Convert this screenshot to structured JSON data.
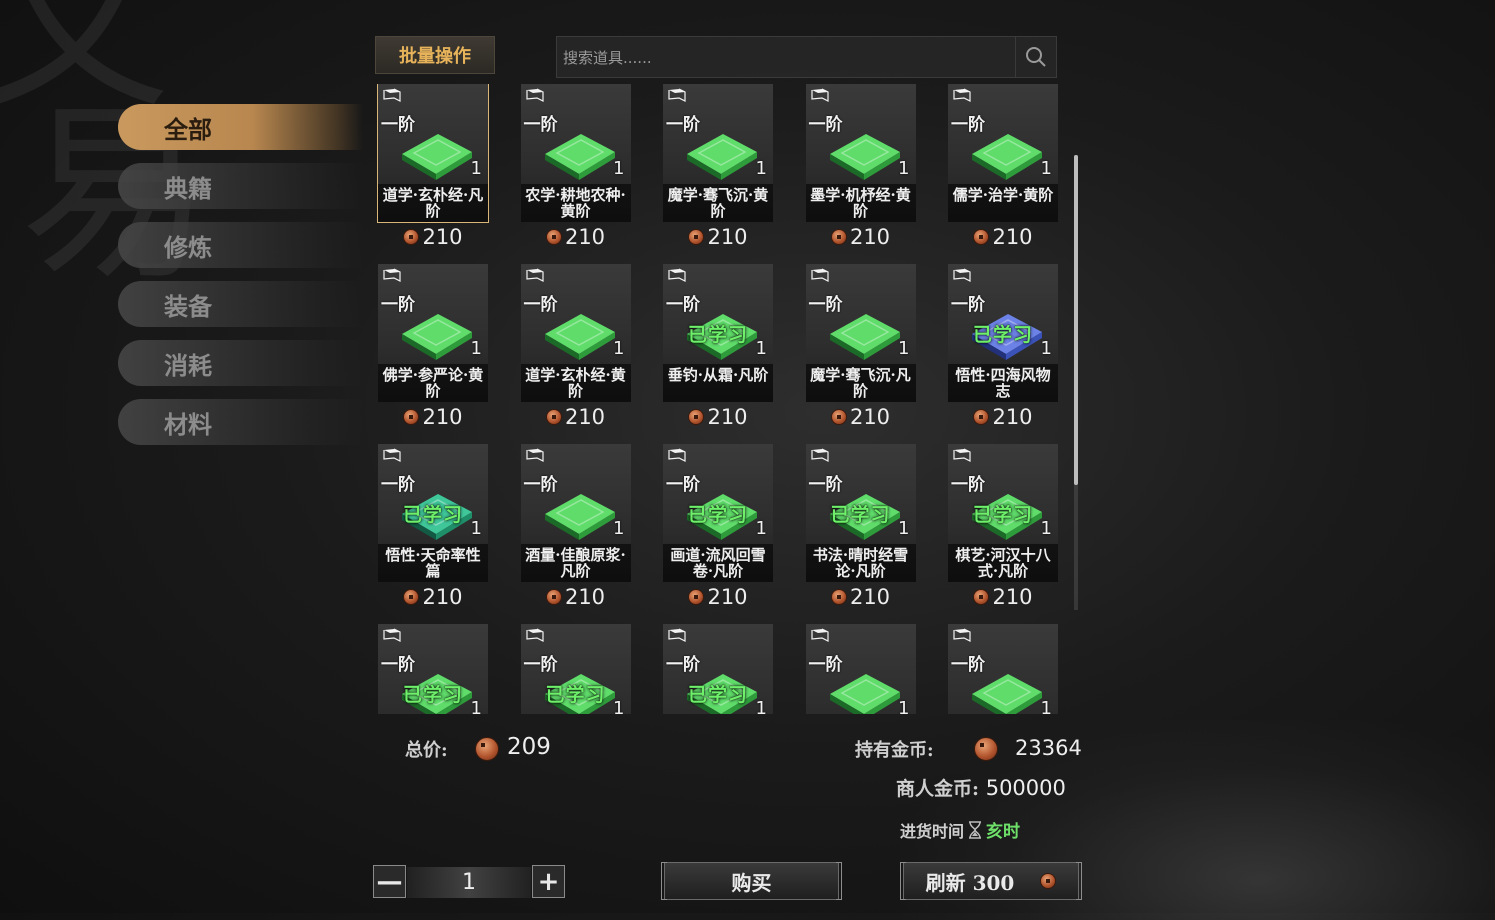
{
  "categories": [
    "全部",
    "典籍",
    "修炼",
    "装备",
    "消耗",
    "材料"
  ],
  "toolbar": {
    "batch_label": "批量操作",
    "search_placeholder": "搜索道具......"
  },
  "items": [
    {
      "tier": "一阶",
      "qty": "1",
      "name": "道学·玄朴经·凡阶",
      "price": "210",
      "learned": false,
      "selected": true,
      "color": "green"
    },
    {
      "tier": "一阶",
      "qty": "1",
      "name": "农学·耕地农种·黄阶",
      "price": "210",
      "learned": false,
      "color": "green"
    },
    {
      "tier": "一阶",
      "qty": "1",
      "name": "魔学·骞飞沉·黄阶",
      "price": "210",
      "learned": false,
      "color": "green"
    },
    {
      "tier": "一阶",
      "qty": "1",
      "name": "墨学·机杼经·黄阶",
      "price": "210",
      "learned": false,
      "color": "green"
    },
    {
      "tier": "一阶",
      "qty": "1",
      "name": "儒学·治学·黄阶",
      "price": "210",
      "learned": false,
      "color": "green"
    },
    {
      "tier": "一阶",
      "qty": "1",
      "name": "佛学·参严论·黄阶",
      "price": "210",
      "learned": false,
      "color": "green"
    },
    {
      "tier": "一阶",
      "qty": "1",
      "name": "道学·玄朴经·黄阶",
      "price": "210",
      "learned": false,
      "color": "green"
    },
    {
      "tier": "一阶",
      "qty": "1",
      "name": "垂钓·从霜·凡阶",
      "price": "210",
      "learned": true,
      "learned_label": "已学习",
      "color": "green"
    },
    {
      "tier": "一阶",
      "qty": "1",
      "name": "魔学·骞飞沉·凡阶",
      "price": "210",
      "learned": false,
      "color": "green"
    },
    {
      "tier": "一阶",
      "qty": "1",
      "name": "悟性·四海风物志",
      "price": "210",
      "learned": true,
      "learned_label": "已学习",
      "color": "blue"
    },
    {
      "tier": "一阶",
      "qty": "1",
      "name": "悟性·天命率性篇",
      "price": "210",
      "learned": true,
      "learned_label": "已学习",
      "color": "teal"
    },
    {
      "tier": "一阶",
      "qty": "1",
      "name": "酒量·佳酿原浆·凡阶",
      "price": "210",
      "learned": false,
      "color": "green"
    },
    {
      "tier": "一阶",
      "qty": "1",
      "name": "画道·流风回雪卷·凡阶",
      "price": "210",
      "learned": true,
      "learned_label": "已学习",
      "color": "green"
    },
    {
      "tier": "一阶",
      "qty": "1",
      "name": "书法·晴时经雪论·凡阶",
      "price": "210",
      "learned": true,
      "learned_label": "已学习",
      "color": "green"
    },
    {
      "tier": "一阶",
      "qty": "1",
      "name": "棋艺·河汉十八式·凡阶",
      "price": "210",
      "learned": true,
      "learned_label": "已学习",
      "color": "green"
    },
    {
      "tier": "一阶",
      "qty": "1",
      "name": "",
      "price": "",
      "learned": true,
      "learned_label": "已学习",
      "color": "green"
    },
    {
      "tier": "一阶",
      "qty": "1",
      "name": "",
      "price": "",
      "learned": true,
      "learned_label": "已学习",
      "color": "green"
    },
    {
      "tier": "一阶",
      "qty": "1",
      "name": "",
      "price": "",
      "learned": true,
      "learned_label": "已学习",
      "color": "green"
    },
    {
      "tier": "一阶",
      "qty": "1",
      "name": "",
      "price": "",
      "learned": false,
      "color": "green"
    },
    {
      "tier": "一阶",
      "qty": "1",
      "name": "",
      "price": "",
      "learned": false,
      "color": "green"
    }
  ],
  "footer": {
    "total_label": "总价:",
    "total_value": "209",
    "own_label": "持有金币:",
    "own_value": "23364",
    "merchant_label": "商人金币:",
    "merchant_value": "500000",
    "restock_label": "进货时间",
    "restock_hour": "亥时",
    "quantity": "1",
    "minus": "—",
    "plus": "+",
    "buy_label": "购买",
    "refresh_label": "刷新 300"
  },
  "colors": {
    "accent_gold": "#c9995e",
    "learned_green": "#6ef06a",
    "book_green": "#3db84a",
    "book_blue": "#3b52b8",
    "book_teal": "#1f8f6a"
  },
  "icons": {
    "coin": "copper-coin-icon",
    "search": "search-icon",
    "book": "book-tag-icon",
    "hourglass": "hourglass-icon"
  }
}
